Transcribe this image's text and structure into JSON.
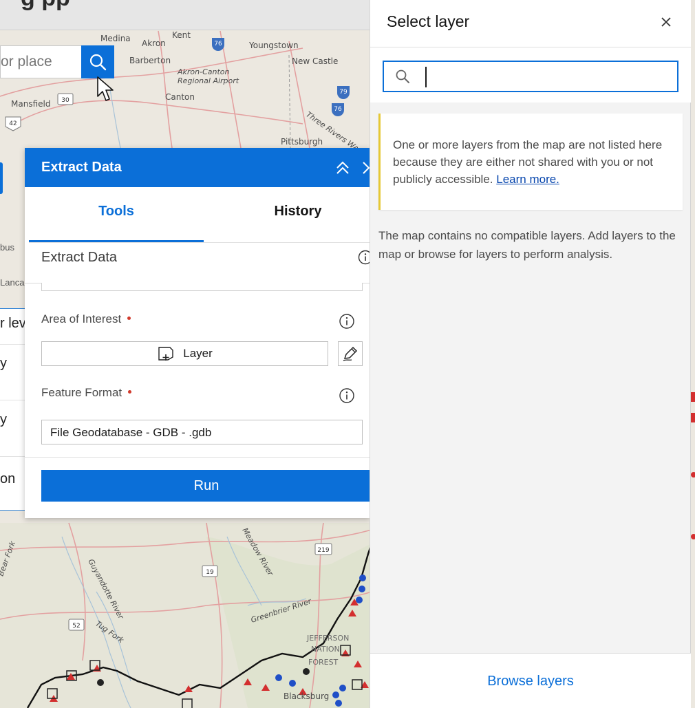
{
  "app": {
    "title": "g   pp"
  },
  "map": {
    "search_placeholder": "or place",
    "labels": {
      "medina": "Medina",
      "kent": "Kent",
      "akron": "Akron",
      "youngstown": "Youngstown",
      "barberton": "Barberton",
      "akron_canton": "Akron-Canton",
      "regional_airport": "Regional Airport",
      "new_castle": "New Castle",
      "mansfield": "Mansfield",
      "canton": "Canton",
      "three_rivers": "Three Rivers Wa",
      "pittsburgh": "Pittsburgh",
      "meadow_river": "Meadow River",
      "guyandotte_river": "Guyandotte River",
      "tug_fork": "Tug Fork",
      "bear_fork": "Bear Fork",
      "greenbrier_river": "Greenbrier River",
      "jefferson": "JEFFERSON",
      "national": "NATION",
      "forest": "FOREST",
      "blacksburg": "Blacksburg",
      "route_76": "76",
      "route_30": "30",
      "route_42": "42",
      "route_79": "79",
      "route_76b": "76",
      "route_219": "219",
      "route_19": "19",
      "route_52": "52"
    }
  },
  "left_panel": {
    "peek_bus": "bus",
    "peek_lanca": "Lanca",
    "fragments": [
      "r lev",
      "y",
      "y",
      "on"
    ]
  },
  "extract": {
    "title": "Extract Data",
    "tabs": {
      "tools": "Tools",
      "history": "History"
    },
    "section_title": "Extract Data",
    "area_label": "Area of Interest",
    "layer_button": "Layer",
    "format_label": "Feature Format",
    "format_value": "File Geodatabase - GDB - .gdb",
    "run_button": "Run"
  },
  "select_layer": {
    "title": "Select layer",
    "search_value": "",
    "notice_text": "One or more layers from the map are not listed here because they are either not shared with you or not publicly accessible.",
    "notice_link": "Learn more.",
    "message": "The map contains no compatible layers. Add layers to the map or browse for layers to perform analysis.",
    "browse_button": "Browse layers"
  },
  "colors": {
    "accent": "#0b6fd8",
    "notice_bar": "#e6c834",
    "required": "#d13a2c"
  }
}
